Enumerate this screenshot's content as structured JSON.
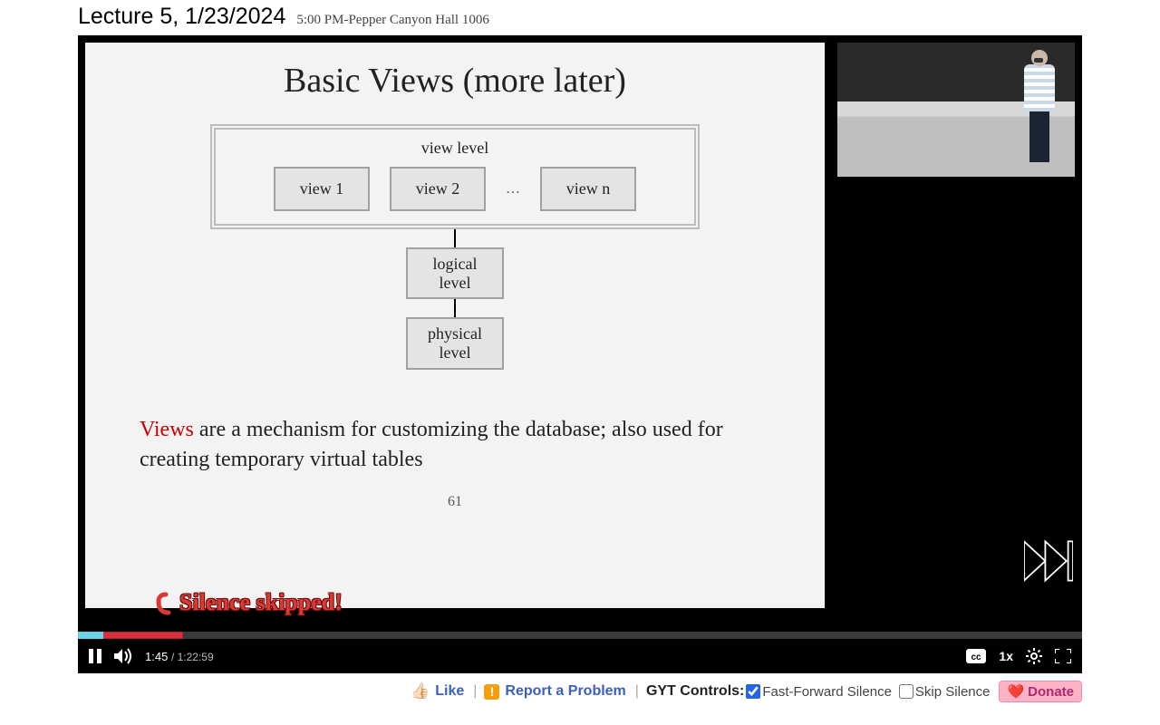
{
  "header": {
    "title": "Lecture 5, 1/23/2024",
    "subtitle": "5:00 PM-Pepper Canyon Hall 1006"
  },
  "slide": {
    "title": "Basic Views (more later)",
    "view_level_label": "view level",
    "views": [
      "view 1",
      "view 2",
      "view n"
    ],
    "dots": "…",
    "logical": "logical\nlevel",
    "physical": "physical\nlevel",
    "desc_red": "Views",
    "desc_rest": " are a mechanism for customizing the database; also used for creating temporary virtual tables",
    "page": "61"
  },
  "overlay": {
    "silence_text": "Silence skipped!"
  },
  "player": {
    "current": "1:45",
    "total": "1:22:59",
    "speed": "1x"
  },
  "bottom": {
    "like": "Like",
    "report": "Report a Problem",
    "gyt_label": "GYT Controls:",
    "ff_label": "Fast-Forward Silence",
    "skip_label": "Skip Silence",
    "donate": "Donate",
    "ff_checked": true,
    "skip_checked": false
  }
}
